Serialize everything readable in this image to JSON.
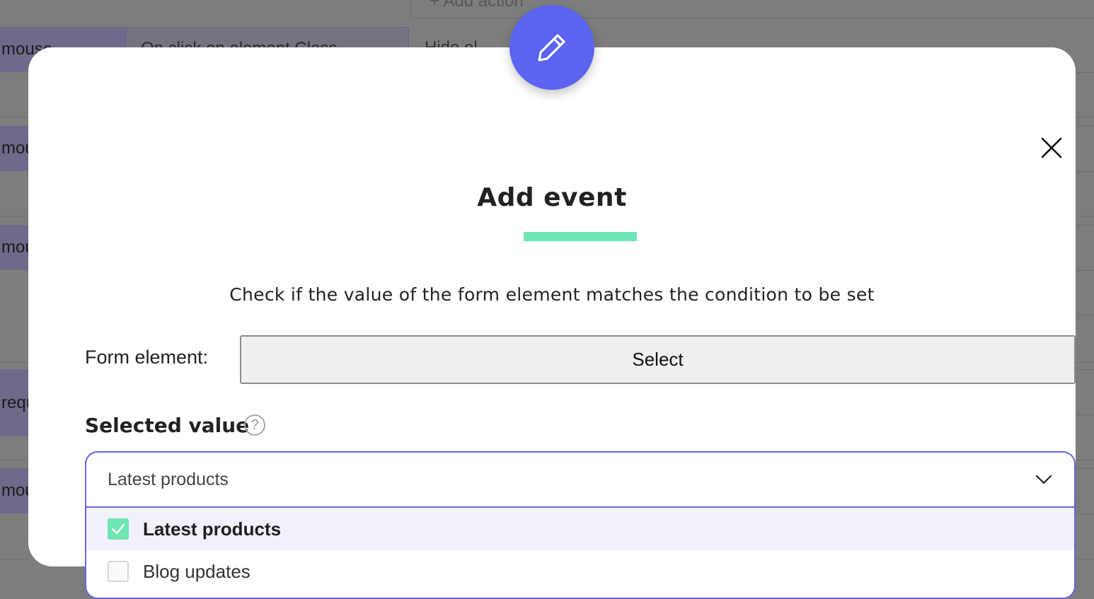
{
  "background": {
    "add_action": "+ Add action",
    "row_tags": [
      "mouse",
      "mou",
      "mou",
      "requ",
      "mou"
    ],
    "row_cell": "On click on element Class",
    "row_value": "Hide el"
  },
  "modal": {
    "badge_icon": "pencil-icon",
    "close_icon": "close-icon",
    "title": "Add event",
    "accent_color": "#6ee6b3",
    "description": "Check if the value of the form element matches the condition to be set",
    "form_element_label": "Form element:",
    "select_button_label": "Select",
    "selected_value_label": "Selected value",
    "help_icon_glyph": "?",
    "dropdown": {
      "current_value": "Latest products",
      "options": [
        {
          "label": "Latest products",
          "checked": true
        },
        {
          "label": "Blog updates",
          "checked": false
        }
      ]
    }
  }
}
